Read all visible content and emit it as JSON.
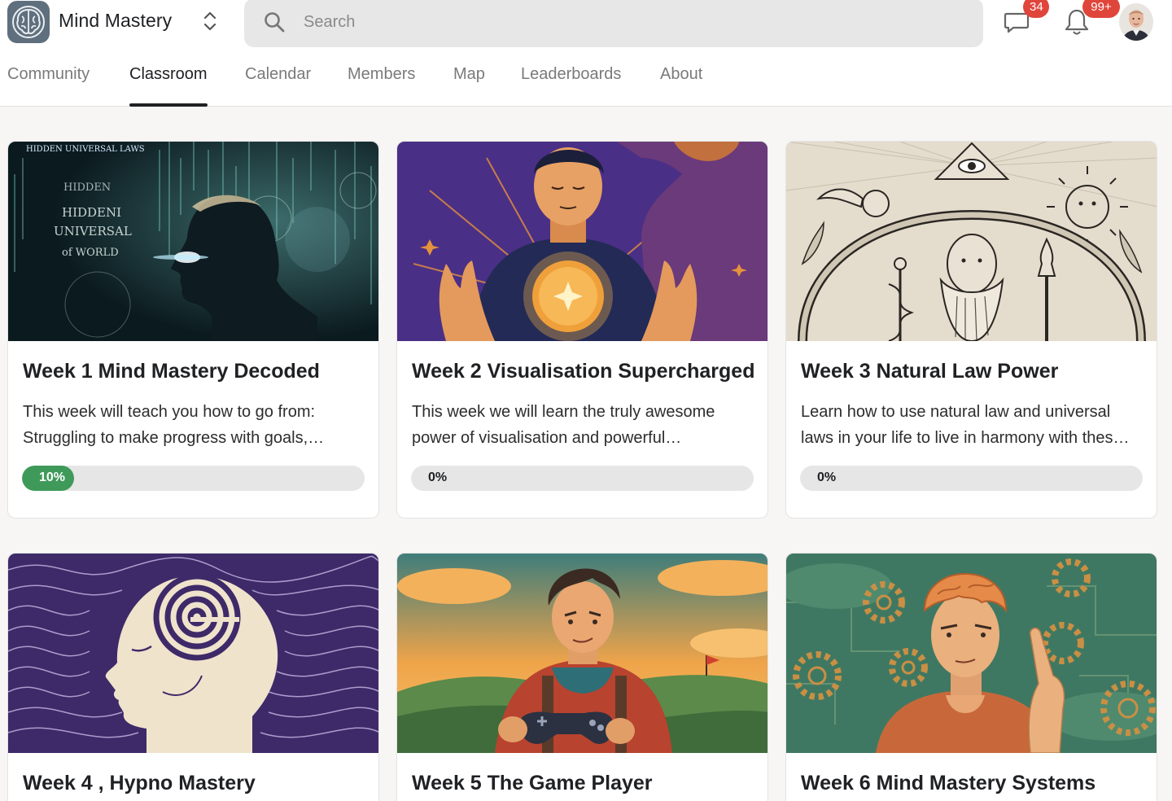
{
  "app": {
    "name": "Mind Mastery",
    "logo_icon": "brain-icon"
  },
  "search": {
    "placeholder": "Search",
    "value": ""
  },
  "notifications": {
    "chat_count": "34",
    "bell_count": "99+",
    "badge_color": "#e0453b"
  },
  "tabs": [
    {
      "label": "Community",
      "active": false
    },
    {
      "label": "Classroom",
      "active": true
    },
    {
      "label": "Calendar",
      "active": false
    },
    {
      "label": "Members",
      "active": false
    },
    {
      "label": "Map",
      "active": false
    },
    {
      "label": "Leaderboards",
      "active": false
    },
    {
      "label": "About",
      "active": false
    }
  ],
  "courses": [
    {
      "title": "Week 1 Mind Mastery Decoded",
      "desc_line1": "This week will teach you how to go from:",
      "desc_line2": "Struggling to make progress with goals,…",
      "progress": 10,
      "progress_label": "10%",
      "image_text": [
        "HIDDEN UNIVERSAL LAWS",
        "HIDDEN",
        "HIDDENI",
        "UNIVERSAL",
        "of WORLD"
      ]
    },
    {
      "title": "Week 2 Visualisation Supercharged",
      "desc_line1": "This week we will learn the truly awesome",
      "desc_line2": "power of visualisation and powerful…",
      "progress": 0,
      "progress_label": "0%"
    },
    {
      "title": "Week 3 Natural Law Power",
      "desc_line1": "Learn how to use natural law and universal",
      "desc_line2": "laws in your life to live in harmony with thes…",
      "progress": 0,
      "progress_label": "0%"
    },
    {
      "title": "Week 4 , Hypno Mastery"
    },
    {
      "title": "Week 5 The Game Player"
    },
    {
      "title": "Week 6 Mind Mastery Systems"
    }
  ],
  "colors": {
    "accent_green": "#3f9a5a",
    "active_tab": "#202124",
    "inactive_tab": "#7a7a7a"
  }
}
